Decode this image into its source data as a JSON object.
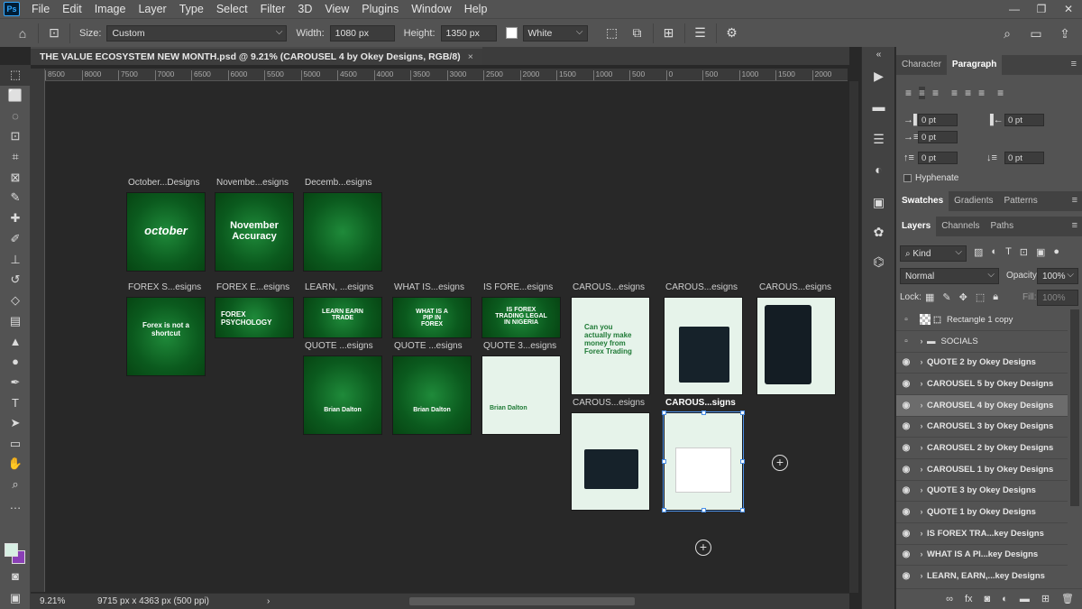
{
  "menu": [
    "File",
    "Edit",
    "Image",
    "Layer",
    "Type",
    "Select",
    "Filter",
    "3D",
    "View",
    "Plugins",
    "Window",
    "Help"
  ],
  "logo": "Ps",
  "window_controls": {
    "minimize": "—",
    "restore": "❐",
    "close": "✕"
  },
  "options": {
    "size_label": "Size:",
    "size_value": "Custom",
    "width_label": "Width:",
    "width_value": "1080 px",
    "height_label": "Height:",
    "height_value": "1350 px",
    "bg_value": "White"
  },
  "document": {
    "tab_title": "THE VALUE ECOSYSTEM NEW MONTH.psd @ 9.21% (CAROUSEL 4 by Okey Designs, RGB/8)",
    "close": "×"
  },
  "ruler": [
    "8500",
    "8000",
    "7500",
    "7000",
    "6500",
    "6000",
    "5500",
    "5000",
    "4500",
    "4000",
    "3500",
    "3000",
    "2500",
    "2000",
    "1500",
    "1000",
    "500",
    "0",
    "500",
    "1000",
    "1500",
    "2000"
  ],
  "artboards": {
    "october": "October...Designs",
    "november": "Novembe...esigns",
    "december": "Decemb...esigns",
    "forex_s": "FOREX S...esigns",
    "forex_e": "FOREX E...esigns",
    "learn": "LEARN, ...esigns",
    "what_is": "WHAT IS...esigns",
    "is_fore": "IS FORE...esigns",
    "carous1": "CAROUS...esigns",
    "carous2": "CAROUS...esigns",
    "carous3": "CAROUS...esigns",
    "quote1": "QUOTE ...esigns",
    "quote2": "QUOTE ...esigns",
    "quote3": "QUOTE 3...esigns",
    "carous4": "CAROUS...esigns",
    "carous5": "CAROUS...signs"
  },
  "artboard_text": {
    "october": "october",
    "november": "November Accuracy",
    "december": "",
    "forex_s": "Forex is not a shortcut",
    "forex_e": "FOREX PSYCHOLOGY",
    "learn": "LEARN EARN TRADE",
    "what_is": "WHAT IS A PIP IN FOREX",
    "is_fore": "IS FOREX TRADING LEGAL IN NIGERIA",
    "carous1": "Can you actually make money from Forex Trading",
    "quote1": "Brian Dalton",
    "quote2": "Brian Dalton",
    "quote3": "Brian Dalton"
  },
  "status": {
    "zoom": "9.21%",
    "info": "9715 px x 4363 px (500 ppi)",
    "arrow": "›"
  },
  "panels": {
    "char_tabs": [
      "Character",
      "Paragraph"
    ],
    "para_fields": [
      "0 pt",
      "0 pt",
      "0 pt",
      "0 pt",
      "0 pt"
    ],
    "hyphenate": "Hyphenate",
    "swatch_tabs": [
      "Swatches",
      "Gradients",
      "Patterns"
    ],
    "layer_tabs": [
      "Layers",
      "Channels",
      "Paths"
    ],
    "kind": "Kind",
    "blend": "Normal",
    "opacity_label": "Opacity:",
    "opacity": "100%",
    "lock_label": "Lock:",
    "fill_label": "Fill:",
    "fill": "100%"
  },
  "layers": [
    {
      "name": "Rectangle 1 copy",
      "visible": false,
      "selected": false
    },
    {
      "name": "SOCIALS",
      "visible": false,
      "selected": false
    },
    {
      "name": "QUOTE 2 by Okey Designs",
      "visible": true,
      "selected": false
    },
    {
      "name": "CAROUSEL 5 by Okey Designs",
      "visible": true,
      "selected": false
    },
    {
      "name": "CAROUSEL 4 by Okey Designs",
      "visible": true,
      "selected": true
    },
    {
      "name": "CAROUSEL 3 by Okey Designs",
      "visible": true,
      "selected": false
    },
    {
      "name": "CAROUSEL 2 by Okey Designs",
      "visible": true,
      "selected": false
    },
    {
      "name": "CAROUSEL 1 by Okey Designs",
      "visible": true,
      "selected": false
    },
    {
      "name": "QUOTE 3 by Okey Designs",
      "visible": true,
      "selected": false
    },
    {
      "name": "QUOTE 1 by Okey Designs",
      "visible": true,
      "selected": false
    },
    {
      "name": "IS FOREX TRA...key Designs",
      "visible": true,
      "selected": false
    },
    {
      "name": "WHAT IS A PI...key Designs",
      "visible": true,
      "selected": false
    },
    {
      "name": "LEARN, EARN,...key Designs",
      "visible": true,
      "selected": false
    }
  ]
}
